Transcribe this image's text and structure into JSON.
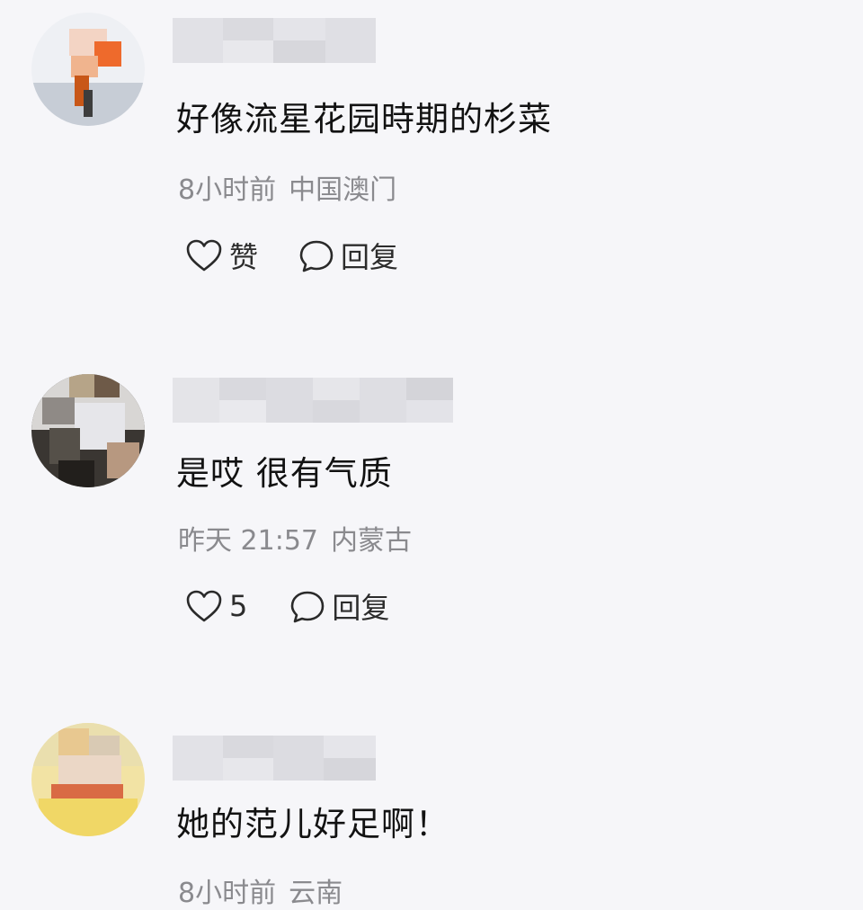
{
  "comments": [
    {
      "text": "好像流星花园時期的杉菜",
      "time": "8小时前",
      "location": "中国澳门",
      "like_label": "赞",
      "reply_label": "回复"
    },
    {
      "text": "是哎 很有气质",
      "time": "昨天 21:57",
      "location": "内蒙古",
      "like_label": "5",
      "reply_label": "回复"
    },
    {
      "text": "她的范儿好足啊！",
      "time": "8小时前",
      "location": "云南"
    }
  ],
  "icons": {
    "like": "heart-outline-icon",
    "reply": "speech-bubble-outline-icon"
  }
}
